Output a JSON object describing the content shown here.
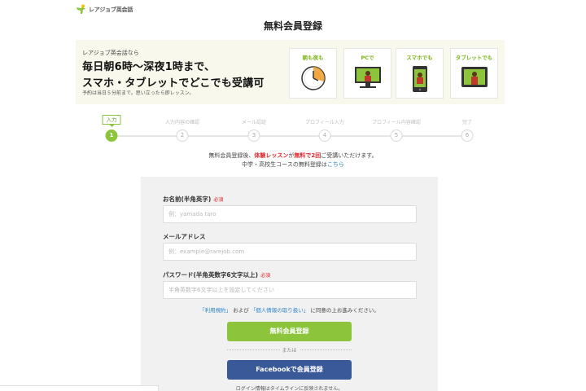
{
  "header": {
    "logo_text": "レアジョブ英会話",
    "page_title": "無料会員登録"
  },
  "banner": {
    "small": "レアジョブ英会話なら",
    "line1": "毎日朝6時〜深夜1時まで、",
    "line2": "スマホ・タブレットでどこでも受講可",
    "note": "予約は当日５分前まで。思い立ったら即レッスン。",
    "features": [
      {
        "label": "朝も夜も",
        "icon": "clock-icon"
      },
      {
        "label": "PCで",
        "icon": "pc-icon"
      },
      {
        "label": "スマホでも",
        "icon": "smartphone-icon"
      },
      {
        "label": "タブレットでも",
        "icon": "tablet-icon"
      }
    ]
  },
  "steps": {
    "current_tag": "入力",
    "items": [
      {
        "number": "1",
        "label": "入力"
      },
      {
        "number": "2",
        "label": "入力内容の確認"
      },
      {
        "number": "3",
        "label": "メール認証"
      },
      {
        "number": "4",
        "label": "プロフィール入力"
      },
      {
        "number": "5",
        "label": "プロフィール内容確認"
      },
      {
        "number": "6",
        "label": "完了"
      }
    ]
  },
  "notice": {
    "line1_a": "無料会員登録後、",
    "line1_red1": "体験レッスン",
    "line1_b": "が",
    "line1_red2": "無料で2回",
    "line1_c": "ご受講いただけます。",
    "line2_a": "中学・高校生コースの無料登録は",
    "line2_link": "こちら"
  },
  "form": {
    "name_label": "お名前(半角英字)",
    "name_placeholder": "例：yamada taro",
    "email_label": "メールアドレス",
    "email_placeholder": "例：example@rarejob.com",
    "password_label": "パスワード(半角英数字6文字以上)",
    "password_placeholder": "半角英数字6文字以上を設定してください",
    "required": "必須",
    "terms_link1": "「利用規約」",
    "terms_and": "および",
    "terms_link2": "「個人情報の取り扱い」",
    "terms_rest": "に同意の上お進みください。",
    "register_button": "無料会員登録",
    "or_text": "または",
    "facebook_button": "Facebookで会員登録",
    "facebook_note": "ログイン情報はタイムラインに反映されません。"
  },
  "colors": {
    "accent_green": "#8cc43c",
    "facebook_blue": "#3a5998",
    "required_red": "#e0262b",
    "link_blue": "#2f86c9"
  }
}
